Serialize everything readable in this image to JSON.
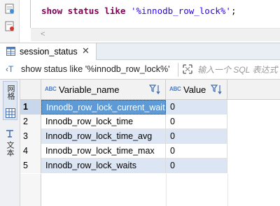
{
  "editor": {
    "sql_keyword": "show status like",
    "sql_string": "'%innodb_row_lock%'",
    "sql_semicolon": ";",
    "scroll_left_arrow": "<"
  },
  "tab": {
    "label": "session_status",
    "close": "✕"
  },
  "filter": {
    "prefix": "‹T",
    "query_text": "show status like '%innodb_row_lock%'",
    "placeholder": "输入一个 SQL 表达式"
  },
  "left_panel": {
    "grid_label": "网格",
    "text_label": "文本"
  },
  "table": {
    "columns": [
      {
        "type_badge": "ABC",
        "label": "Variable_name"
      },
      {
        "type_badge": "ABC",
        "label": "Value"
      }
    ],
    "rows": [
      {
        "num": "1",
        "name": "Innodb_row_lock_current_waits",
        "value": "0"
      },
      {
        "num": "2",
        "name": "Innodb_row_lock_time",
        "value": "0"
      },
      {
        "num": "3",
        "name": "Innodb_row_lock_time_avg",
        "value": "0"
      },
      {
        "num": "4",
        "name": "Innodb_row_lock_time_max",
        "value": "0"
      },
      {
        "num": "5",
        "name": "Innodb_row_lock_waits",
        "value": "0"
      }
    ]
  },
  "colors": {
    "keyword": "#7f0055",
    "string": "#2a00ff",
    "selection": "#5d9ad6",
    "alt_row": "#dbe5f4"
  }
}
